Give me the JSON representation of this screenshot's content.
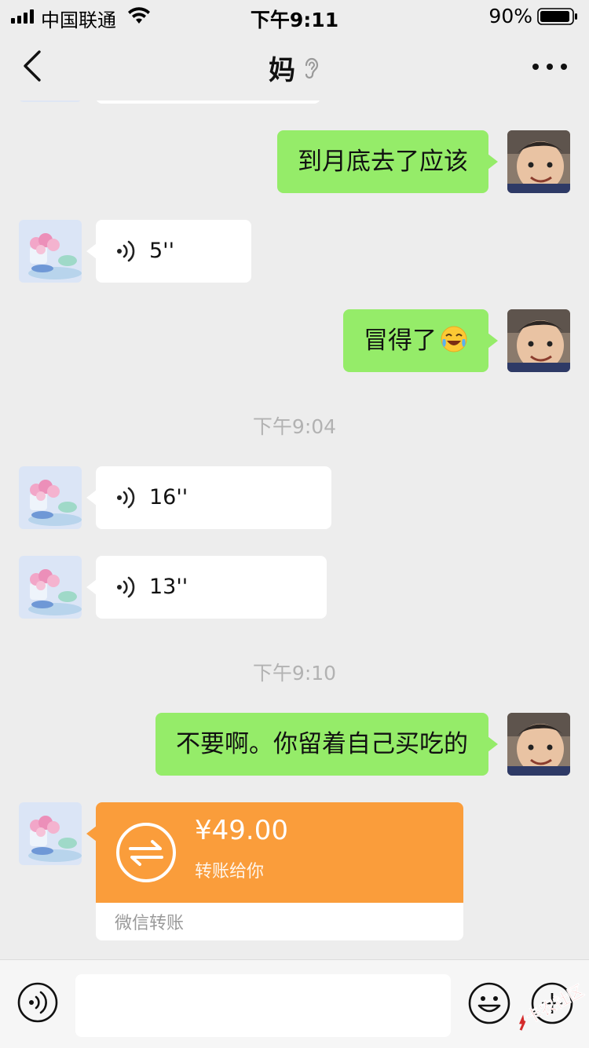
{
  "status_bar": {
    "carrier": "中国联通",
    "time": "下午9:11",
    "battery": "90%"
  },
  "nav": {
    "title": "妈",
    "more": "···"
  },
  "messages": [
    {
      "type": "text",
      "side": "me",
      "text": "到月底去了应该"
    },
    {
      "type": "voice",
      "side": "them",
      "duration": "5''"
    },
    {
      "type": "text",
      "side": "me",
      "text": "冒得了"
    },
    {
      "type": "time",
      "text": "下午9:04"
    },
    {
      "type": "voice",
      "side": "them",
      "duration": "16''"
    },
    {
      "type": "voice",
      "side": "them",
      "duration": "13''"
    },
    {
      "type": "time",
      "text": "下午9:10"
    },
    {
      "type": "text",
      "side": "me",
      "text": "不要啊。你留着自己买吃的"
    },
    {
      "type": "transfer",
      "side": "them",
      "amount": "¥49.00",
      "desc": "转账给你",
      "footer": "微信转账"
    }
  ],
  "watermark": {
    "text": "卡农社区"
  },
  "colors": {
    "bubble_me": "#95ec69",
    "bubble_them": "#ffffff",
    "transfer": "#fa9d3b",
    "background": "#ededed"
  }
}
